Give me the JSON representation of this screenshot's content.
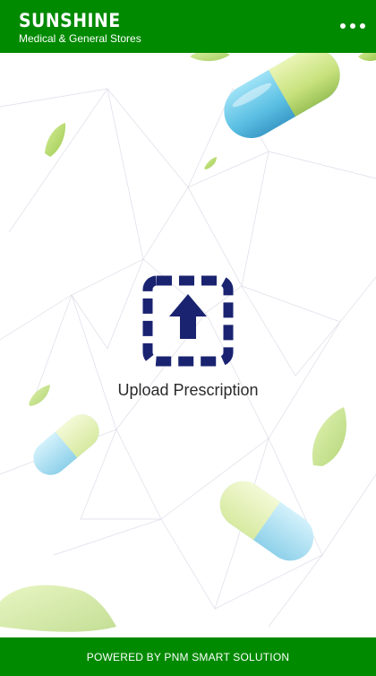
{
  "header": {
    "title": "SUNSHINE",
    "subtitle": "Medical & General Stores",
    "menu_icon": "more-horizontal-icon"
  },
  "main": {
    "upload_label": "Upload Prescription",
    "upload_icon": "upload-arrow-icon"
  },
  "footer": {
    "text": "POWERED BY PNM SMART SOLUTION"
  },
  "colors": {
    "brand_green": "#008a00",
    "icon_navy": "#1a2370",
    "capsule_blue": "#66c4e8",
    "capsule_green": "#c6e07a",
    "leaf_green": "#a6d35b"
  }
}
